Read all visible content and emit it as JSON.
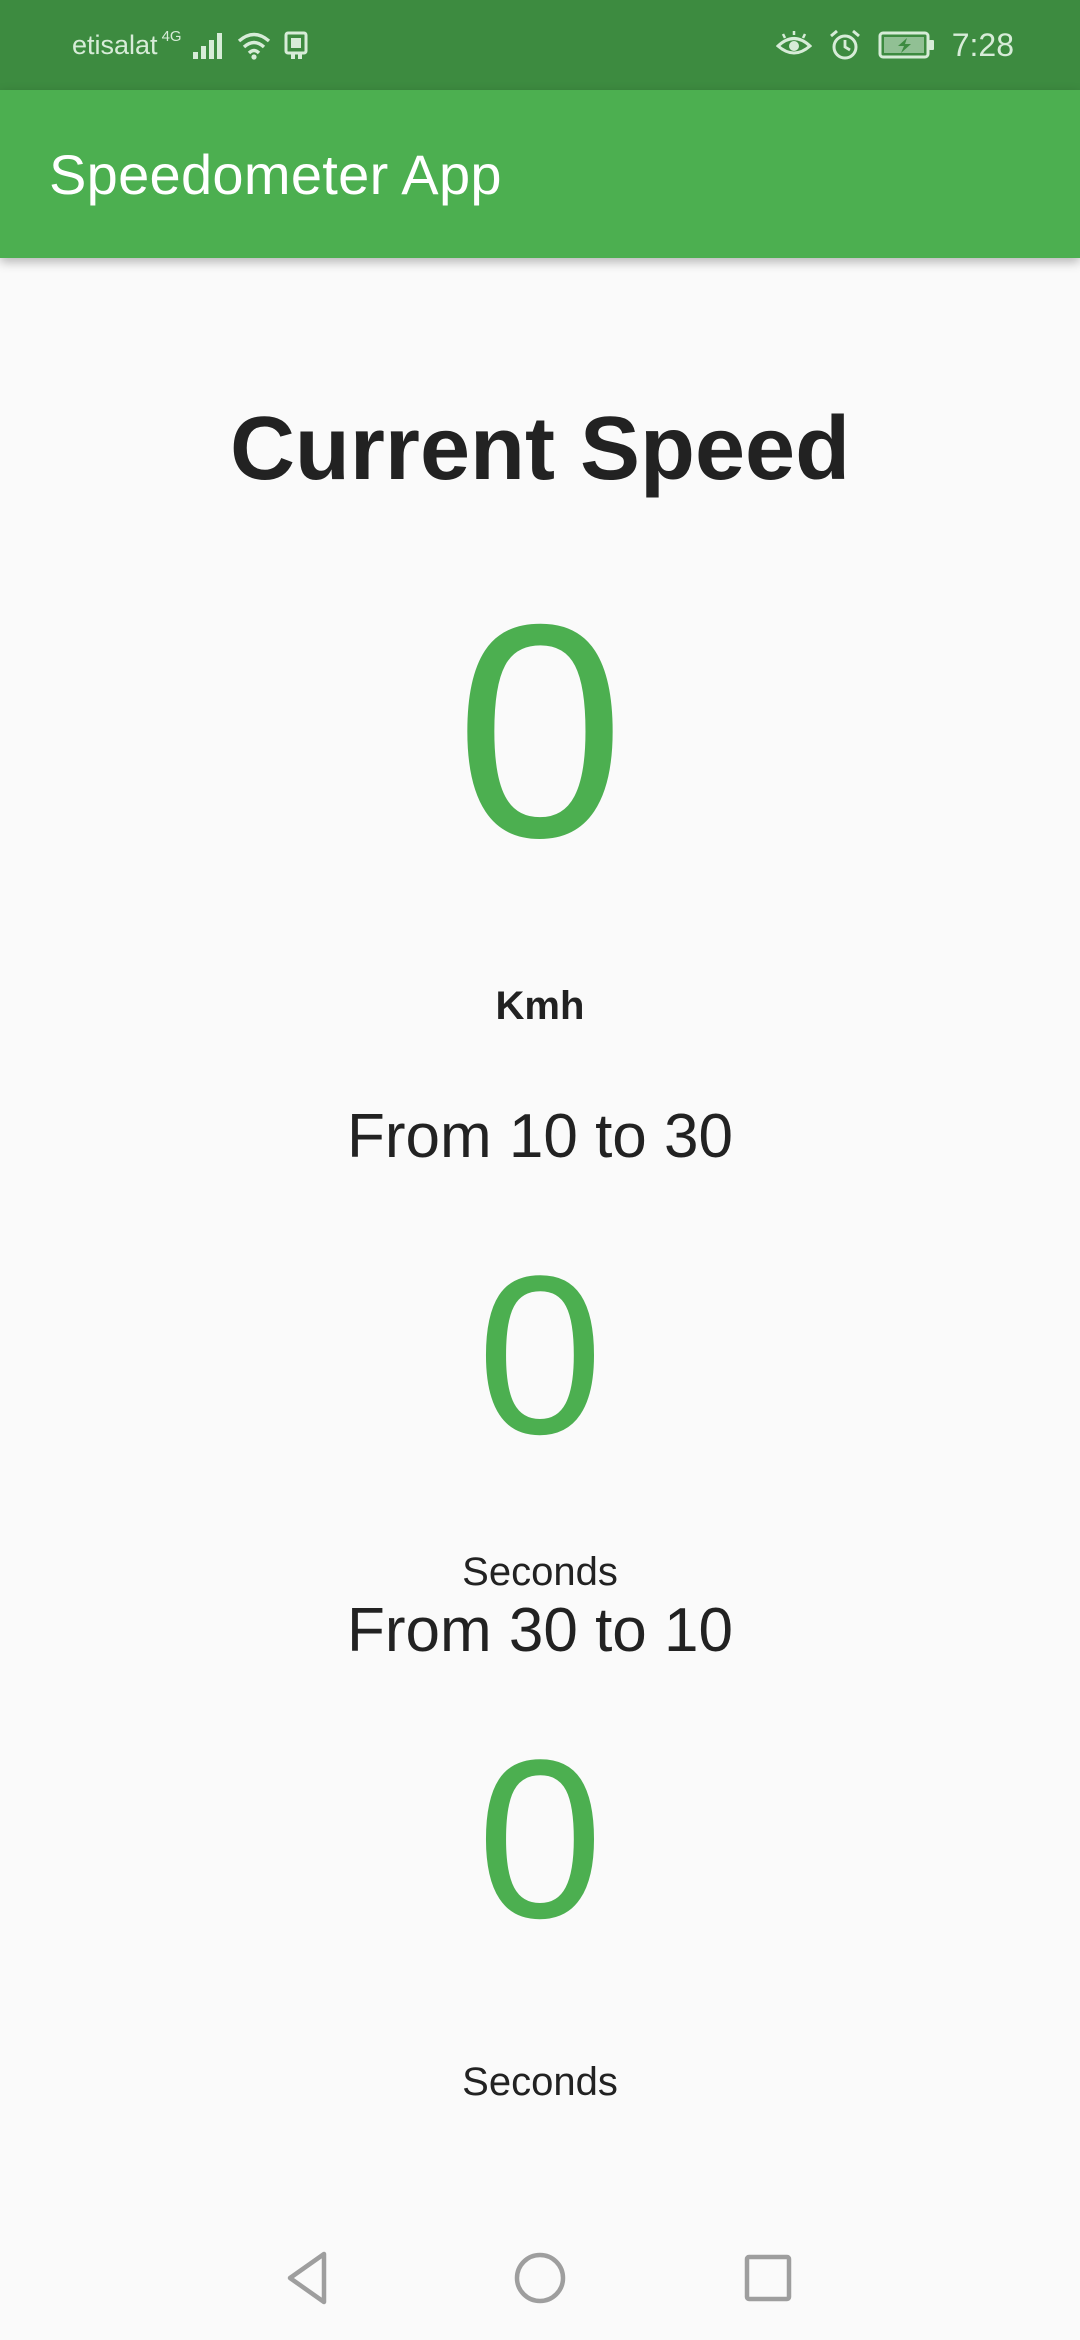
{
  "status_bar": {
    "carrier": "etisalat",
    "network_type": "4G",
    "time": "7:28",
    "icons": [
      "signal-icon",
      "wifi-icon",
      "sim-icon",
      "eye-comfort-icon",
      "alarm-icon",
      "battery-charging-icon"
    ]
  },
  "app_bar": {
    "title": "Speedometer App",
    "color": "#4caf50"
  },
  "speed": {
    "heading": "Current Speed",
    "value": "0",
    "unit": "Kmh"
  },
  "accel_10_30": {
    "label": "From 10 to 30",
    "value": "0",
    "unit": "Seconds"
  },
  "decel_30_10": {
    "label": "From 30 to 10",
    "value": "0",
    "unit": "Seconds"
  },
  "nav_bar": {
    "buttons": [
      "back-icon",
      "home-icon",
      "recents-icon"
    ]
  },
  "colors": {
    "accent": "#4caf50",
    "status_bar": "#3d8b40",
    "text": "#222222",
    "background": "#fafafa"
  }
}
